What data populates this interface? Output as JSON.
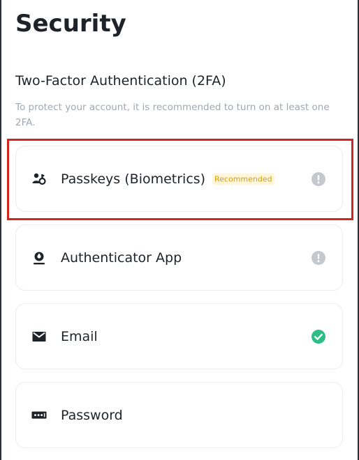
{
  "page": {
    "title": "Security"
  },
  "two_factor": {
    "heading": "Two-Factor Authentication (2FA)",
    "description": "To protect your account, it is recommended to turn on at least one 2FA."
  },
  "methods": [
    {
      "label": "Passkeys (Biometrics)",
      "badge": "Recommended",
      "icon": "passkey-icon",
      "status": "not-enabled",
      "status_icon": "info-icon",
      "highlighted": true
    },
    {
      "label": "Authenticator App",
      "icon": "authenticator-icon",
      "status": "not-enabled",
      "status_icon": "info-icon"
    },
    {
      "label": "Email",
      "icon": "envelope-icon",
      "status": "enabled",
      "status_icon": "check-circle-icon"
    },
    {
      "label": "Password",
      "icon": "password-icon",
      "status": "none"
    }
  ],
  "colors": {
    "text_primary": "#1e2329",
    "text_secondary": "#a1a7b0",
    "badge_text": "#d89f00",
    "badge_bg": "#fdf6dc",
    "status_enabled": "#2ebd85",
    "status_neutral": "#c4c8cf",
    "highlight": "#d4241f",
    "card_border": "#eaecef"
  }
}
